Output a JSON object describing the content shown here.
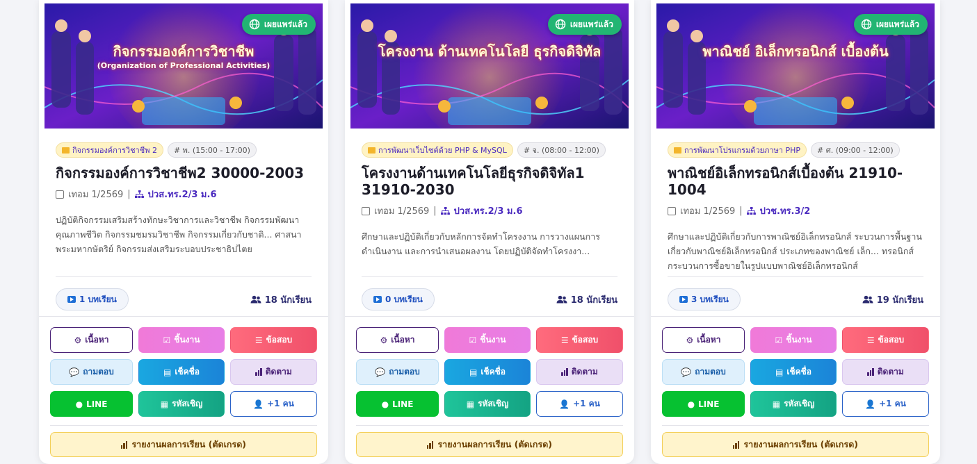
{
  "colors": {
    "accent": "#4a2277",
    "published": "#22b573",
    "line": "#06c131"
  },
  "cards": [
    {
      "banner_title": "กิจกรรมองค์การวิชาชีพ",
      "banner_subtitle": "(Organization of Professional Activities)",
      "published_label": "เผยแพร่แล้ว",
      "subject_tag": "กิจกรรมองค์การวิชาชีพ 2",
      "time_tag": "# พ. (15:00 - 17:00)",
      "title": "กิจกรรมองค์การวิชาชีพ2 30000-2003",
      "term": "เทอม 1/2569",
      "level": "ปวส.ทร.2/3 ม.6",
      "description": "ปฏิบัติกิจกรรมเสริมสร้างทักษะวิชาการและวิชาชีพ กิจกรรมพัฒนาคุณภาพชีวิต กิจกรรมชมรมวิชาชีพ กิจกรรมเกี่ยวกับชาติ... ศาสนา พระมหากษัตริย์ กิจกรรมส่งเสริมระบอบประชาธิปไตย",
      "lessons": "1 บทเรียน",
      "students": "18 นักเรียน"
    },
    {
      "banner_title": "โครงงาน ด้านเทคโนโลยี ธุรกิจดิจิทัล",
      "banner_subtitle": "",
      "published_label": "เผยแพร่แล้ว",
      "subject_tag": "การพัฒนาเว็บไซต์ด้วย PHP & MySQL",
      "time_tag": "# จ. (08:00 - 12:00)",
      "title": "โครงงานด้านเทคโนโลยีธุรกิจดิจิทัล1 31910-2030",
      "term": "เทอม 1/2569",
      "level": "ปวส.ทร.2/3 ม.6",
      "description": "ศึกษาและปฏิบัติเกี่ยวกับหลักการจัดทำโครงงาน การวางแผนการดำเนินงาน และการนำเสนอผลงาน โดยปฏิบัติจัดทำโครงงา...",
      "lessons": "0 บทเรียน",
      "students": "18 นักเรียน"
    },
    {
      "banner_title": "พาณิชย์ อิเล็กทรอนิกส์ เบื้องต้น",
      "banner_subtitle": "",
      "published_label": "เผยแพร่แล้ว",
      "subject_tag": "การพัฒนาโปรแกรมด้วยภาษา PHP",
      "time_tag": "# ศ. (09:00 - 12:00)",
      "title": "พาณิชย์อิเล็กทรอนิกส์เบื้องต้น 21910-1004",
      "term": "เทอม 1/2569",
      "level": "ปวช.ทร.3/2",
      "description": "ศึกษาและปฏิบัติเกี่ยวกับการพาณิชย์อิเล็กทรอนิกส์ ระบวนการพื้นฐานเกี่ยวกับพาณิชย์อิเล็กทรอนิกส์ ประเภทของพาณิชย์ เล็ก... ทรอนิกส์ กระบวนการซื้อขายในรูปแบบพาณิชย์อิเล็กทรอนิกส์",
      "lessons": "3 บทเรียน",
      "students": "19 นักเรียน"
    }
  ],
  "buttons": {
    "content": "เนื้อหา",
    "work": "ชิ้นงาน",
    "exam": "ข้อสอบ",
    "qa": "ถามตอบ",
    "checkin": "เช็คชื่อ",
    "track": "ติดตาม",
    "line": "LINE",
    "invite": "รหัสเชิญ",
    "add": "+1 คน",
    "report": "รายงานผลการเรียน (ตัดเกรด)"
  }
}
